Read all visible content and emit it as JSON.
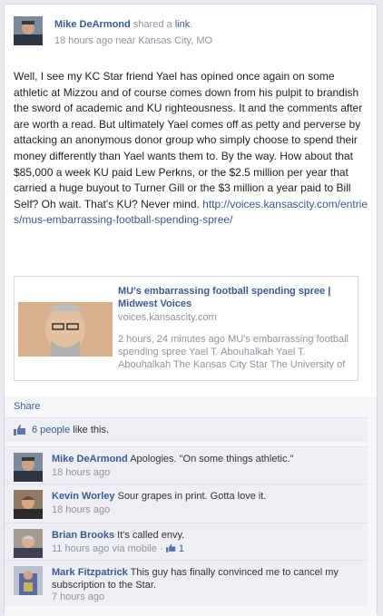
{
  "post": {
    "author": "Mike DeArmond",
    "action_prefix": "shared a ",
    "action_link": "link",
    "action_suffix": ".",
    "time": "18 hours ago near Kansas City, MO",
    "body": "Well, I see my KC Star friend Yael has opined once again on some athletic at Mizzou and of course comes down from his pulpit to brandish the sword of academic and KU righteousness. It and the comments after are worth a read. But ultimately Yael comes off as petty and perverse by attacking an anonymous donor group who simply choose to spend their money differently than Yael wants them to. By the way. How about that $85,000 a week KU paid Lew Perkns, or the $2.5 million per year that carried a huge buyout to Turner Gill or the $3 million a year paid to Bill Self? Oh wait. That's KU? Never mind.",
    "url": "http://voices.kansascity.com/entries/mus-embarrassing-football-spending-spree/"
  },
  "preview": {
    "title": "MU's embarrassing football spending spree | Midwest Voices",
    "host": "voices.kansascity.com",
    "description": "2 hours, 24 minutes ago MU's embarrassing football spending spree Yael T. Abouhalkah Yael T. Abouhalkah The Kansas City Star The University of"
  },
  "actions": {
    "share": "Share",
    "likes_link": "6 people",
    "likes_suffix": " like this."
  },
  "comments": [
    {
      "author": "Mike DeArmond",
      "text": "Apologies. \"On some things athletic.\"",
      "time": "18 hours ago"
    },
    {
      "author": "Kevin Worley",
      "text": "Sour grapes in print. Gotta love it.",
      "time": "18 hours ago"
    },
    {
      "author": "Brian Brooks",
      "text": "It's called envy.",
      "time": "11 hours ago via mobile · ",
      "like_count": "1"
    },
    {
      "author": "Mark Fitzpatrick",
      "text": "This guy has finally convinced me to cancel my subscription to the Star.",
      "time": "7 hours ago"
    }
  ],
  "colors": {
    "link": "#3b5998",
    "meta": "#90949c",
    "background": "#e9ebee"
  }
}
